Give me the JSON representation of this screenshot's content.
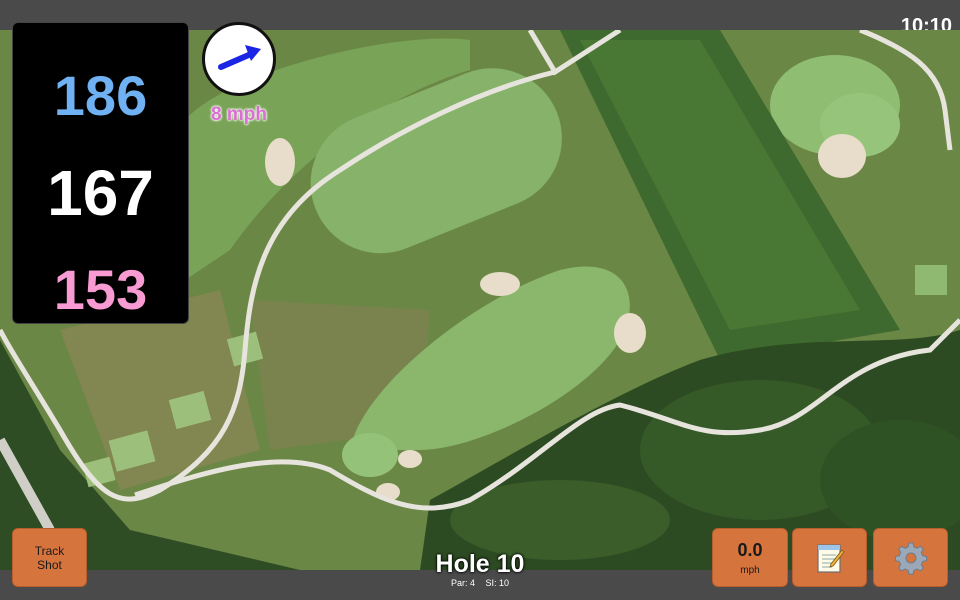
{
  "status": {
    "time": "10:10"
  },
  "distances": {
    "back": "186",
    "center": "167",
    "front": "153"
  },
  "wind": {
    "speed_label": "8 mph",
    "icon": "wind-direction-arrow-icon"
  },
  "hole": {
    "title": "Hole 10",
    "par": "Par: 4",
    "stroke_index": "SI: 10"
  },
  "buttons": {
    "track_shot_line1": "Track",
    "track_shot_line2": "Shot",
    "speed_value": "0.0",
    "speed_unit": "mph",
    "notes_icon": "notepad-icon",
    "settings_icon": "gear-icon"
  },
  "colors": {
    "back_distance": "#6fb1f2",
    "center_distance": "#ffffff",
    "front_distance": "#f79bd2",
    "button_accent": "#d6743e",
    "wind_text": "#d96fd0"
  }
}
